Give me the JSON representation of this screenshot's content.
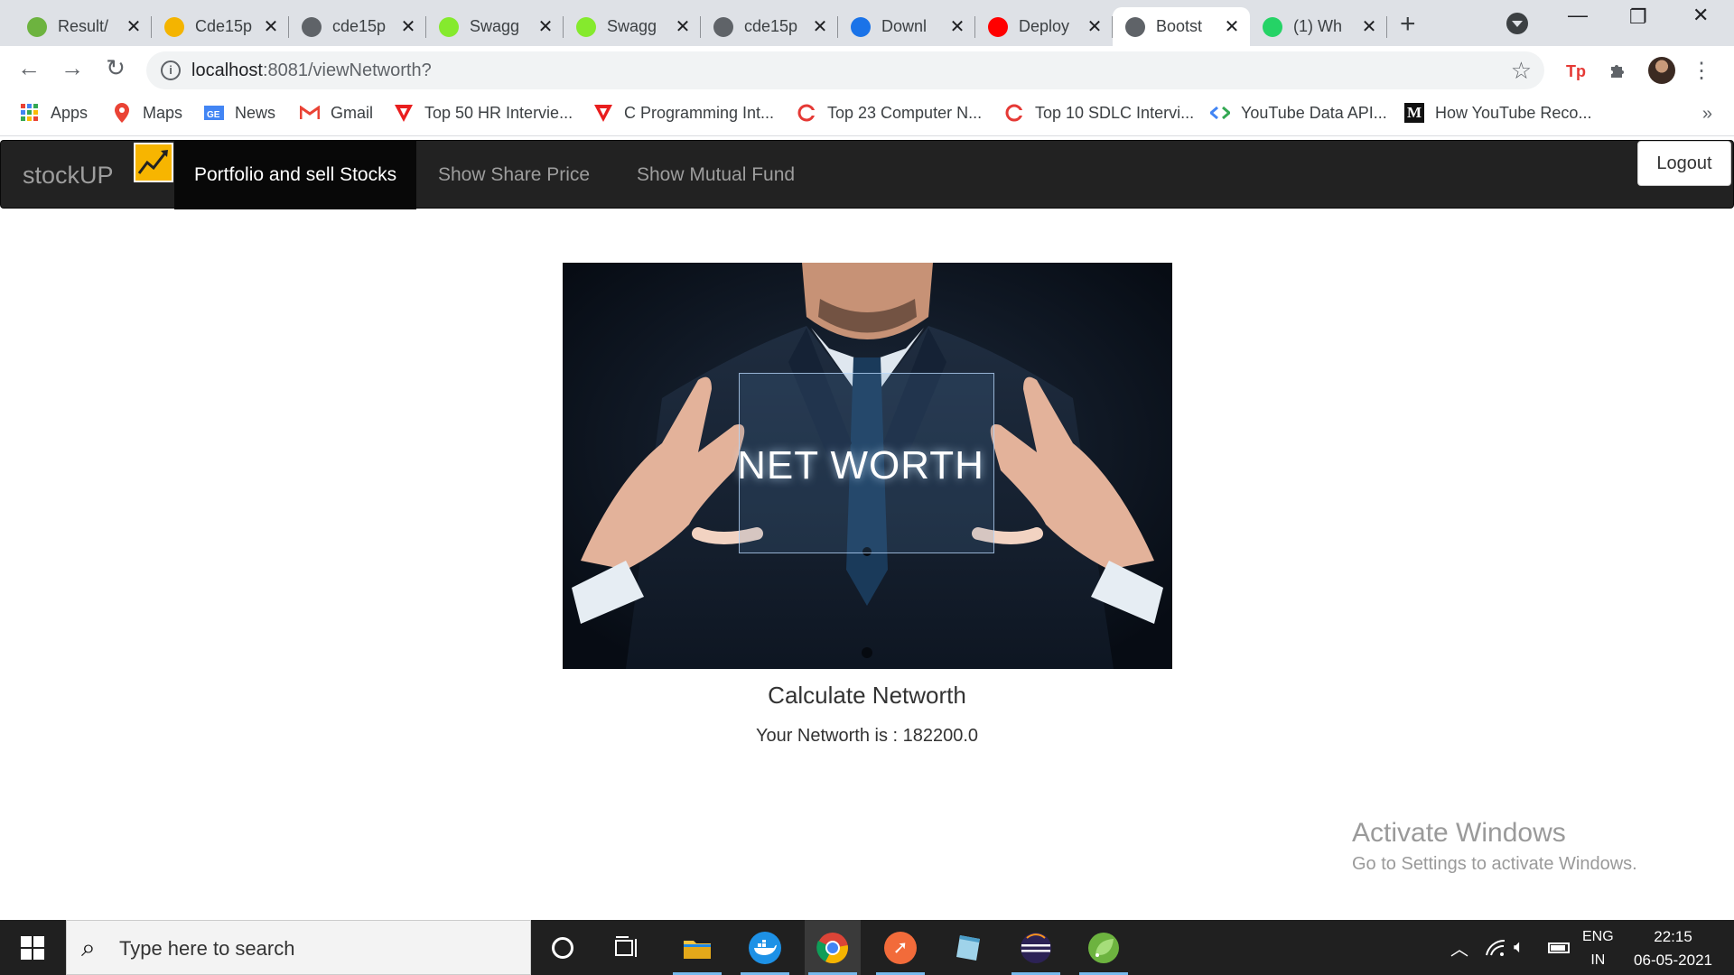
{
  "browser": {
    "tabs": [
      {
        "title": "Result/",
        "icon": "spring-icon",
        "color": "#6db33f"
      },
      {
        "title": "Cde15p",
        "icon": "box-icon",
        "color": "#f4b400"
      },
      {
        "title": "cde15p",
        "icon": "globe-icon",
        "color": "#5f6368"
      },
      {
        "title": "Swagg",
        "icon": "swagger-icon",
        "color": "#85ea2d"
      },
      {
        "title": "Swagg",
        "icon": "swagger-icon",
        "color": "#85ea2d"
      },
      {
        "title": "cde15p",
        "icon": "globe-icon",
        "color": "#5f6368"
      },
      {
        "title": "Downl",
        "icon": "download-icon",
        "color": "#1a73e8"
      },
      {
        "title": "Deploy",
        "icon": "youtube-icon",
        "color": "#ff0000"
      },
      {
        "title": "Bootst",
        "icon": "globe-icon",
        "color": "#5f6368",
        "active": true
      },
      {
        "title": "(1) Wh",
        "icon": "whatsapp-icon",
        "color": "#25d366"
      }
    ],
    "url_host": "localhost",
    "url_path": ":8081/viewNetworth?",
    "bookmarks": [
      {
        "label": "Apps",
        "icon": "apps-grid-icon"
      },
      {
        "label": "Maps",
        "icon": "maps-pin-icon"
      },
      {
        "label": "News",
        "icon": "news-icon"
      },
      {
        "label": "Gmail",
        "icon": "gmail-icon"
      },
      {
        "label": "Top 50 HR Intervie...",
        "icon": "v-logo-icon"
      },
      {
        "label": "C Programming Int...",
        "icon": "v-logo-icon"
      },
      {
        "label": "Top 23 Computer N...",
        "icon": "c-logo-icon"
      },
      {
        "label": "Top 10 SDLC Intervi...",
        "icon": "c-logo-icon"
      },
      {
        "label": "YouTube Data API...",
        "icon": "code-icon"
      },
      {
        "label": "How YouTube Reco...",
        "icon": "medium-icon"
      }
    ],
    "more_bookmarks": "»"
  },
  "app": {
    "brand": "stockUP",
    "nav": [
      {
        "label": "Portfolio and sell Stocks",
        "active": true
      },
      {
        "label": "Show Share Price",
        "active": false
      },
      {
        "label": "Show Mutual Fund",
        "active": false
      }
    ],
    "logout_label": "Logout",
    "hero_text": "NET WORTH",
    "calc_title": "Calculate Networth",
    "networth_text": "Your Networth is : 182200.0"
  },
  "watermark": {
    "line1": "Activate Windows",
    "line2": "Go to Settings to activate Windows."
  },
  "taskbar": {
    "search_placeholder": "Type here to search",
    "lang_top": "ENG",
    "lang_bottom": "IN",
    "time": "22:15",
    "date": "06-05-2021"
  }
}
